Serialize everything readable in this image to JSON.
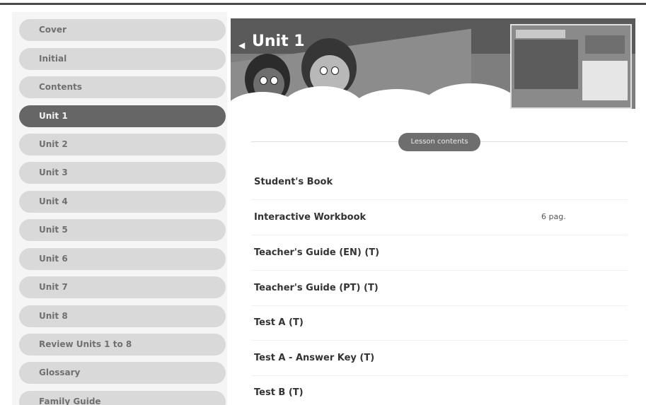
{
  "sidebar": {
    "items": [
      {
        "label": "Cover"
      },
      {
        "label": "Initial"
      },
      {
        "label": "Contents"
      },
      {
        "label": "Unit 1"
      },
      {
        "label": "Unit 2"
      },
      {
        "label": "Unit 3"
      },
      {
        "label": "Unit 4"
      },
      {
        "label": "Unit 5"
      },
      {
        "label": "Unit 6"
      },
      {
        "label": "Unit 7"
      },
      {
        "label": "Unit 8"
      },
      {
        "label": "Review Units 1 to 8"
      },
      {
        "label": "Glossary"
      },
      {
        "label": "Family Guide"
      }
    ],
    "active": "Unit 1"
  },
  "banner": {
    "title": "Unit 1"
  },
  "lesson": {
    "pill_label": "Lesson contents",
    "items": [
      {
        "title": "Student's Book",
        "pages": ""
      },
      {
        "title": "Interactive Workbook",
        "pages": "6 pag."
      },
      {
        "title": "Teacher's Guide (EN) (T)",
        "pages": ""
      },
      {
        "title": "Teacher's Guide (PT) (T)",
        "pages": ""
      },
      {
        "title": "Test A (T)",
        "pages": ""
      },
      {
        "title": "Test A - Answer Key (T)",
        "pages": ""
      },
      {
        "title": "Test B (T)",
        "pages": ""
      }
    ]
  },
  "icons": {
    "back": "chevron-left-icon"
  },
  "colors": {
    "active_item_bg": "#666666",
    "item_bg": "#d9d9d9",
    "pill_bg": "#6e6e6e"
  }
}
